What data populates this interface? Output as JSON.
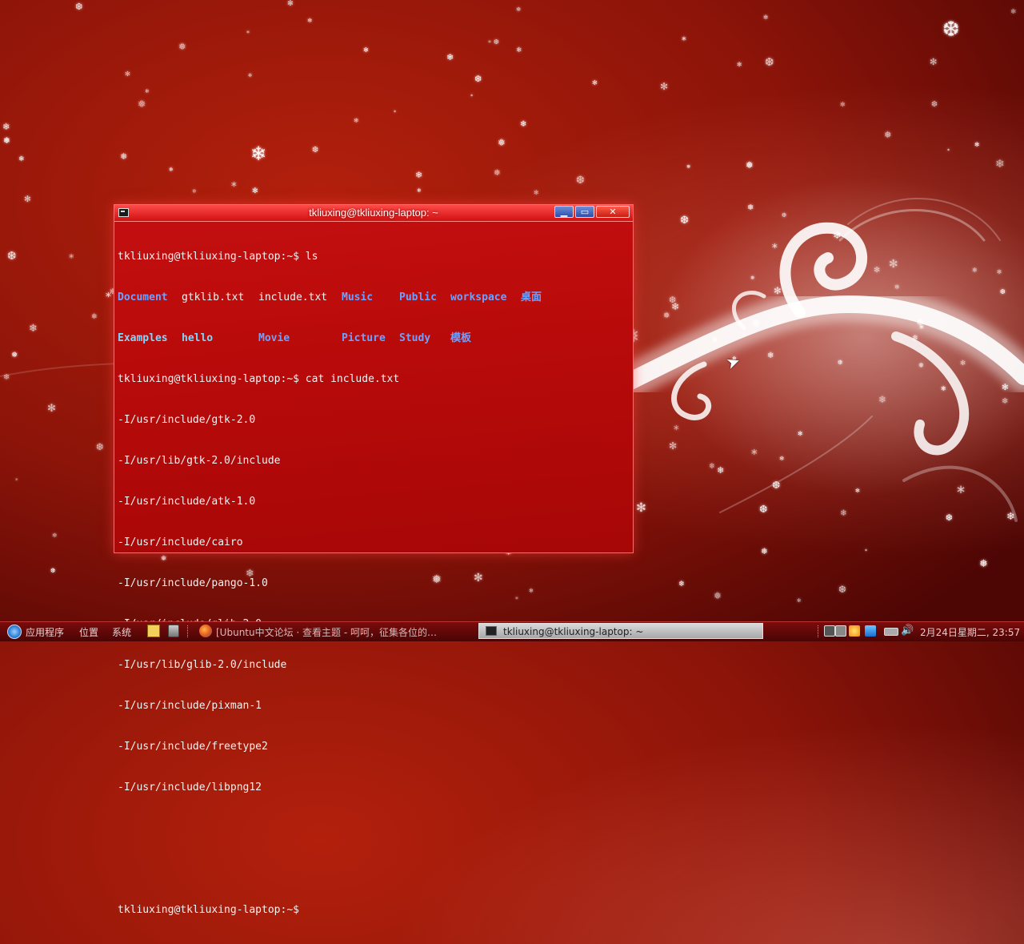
{
  "terminal": {
    "title": "tkliuxing@tkliuxing-laptop: ~",
    "buttons": {
      "minimize": "▁",
      "maximize": "▭",
      "close": "✕"
    },
    "lines": {
      "l1": "tkliuxing@tkliuxing-laptop:~$ ls",
      "ls_row1": [
        "Document",
        "gtklib.txt",
        "include.txt",
        "Music",
        "Public",
        "workspace",
        "桌面"
      ],
      "ls_row2": [
        "Examples",
        "hello",
        "Movie",
        "Picture",
        "Study",
        "模板"
      ],
      "l4": "tkliuxing@tkliuxing-laptop:~$ cat include.txt",
      "includes": [
        "-I/usr/include/gtk-2.0",
        "-I/usr/lib/gtk-2.0/include",
        "-I/usr/include/atk-1.0",
        "-I/usr/include/cairo",
        "-I/usr/include/pango-1.0",
        "-I/usr/include/glib-2.0",
        "-I/usr/lib/glib-2.0/include",
        "-I/usr/include/pixman-1",
        "-I/usr/include/freetype2",
        "-I/usr/include/libpng12"
      ],
      "prompt": "tkliuxing@tkliuxing-laptop:~$"
    }
  },
  "taskbar": {
    "menu_applications": "应用程序",
    "menu_places": "位置",
    "menu_system": "系统",
    "task_firefox": "[Ubuntu中文论坛 · 查看主题 - 呵呵，征集各位的…",
    "task_terminal": "tkliuxing@tkliuxing-laptop: ~",
    "clock": "2月24日星期二, 23:57",
    "volume_glyph": "🔊"
  },
  "colors": {
    "terminal_bg": "#b80a0a",
    "dir_blue": "#6fa0ff",
    "exe_cyan": "#7dd8ff",
    "wallpaper": "#8c1409"
  }
}
